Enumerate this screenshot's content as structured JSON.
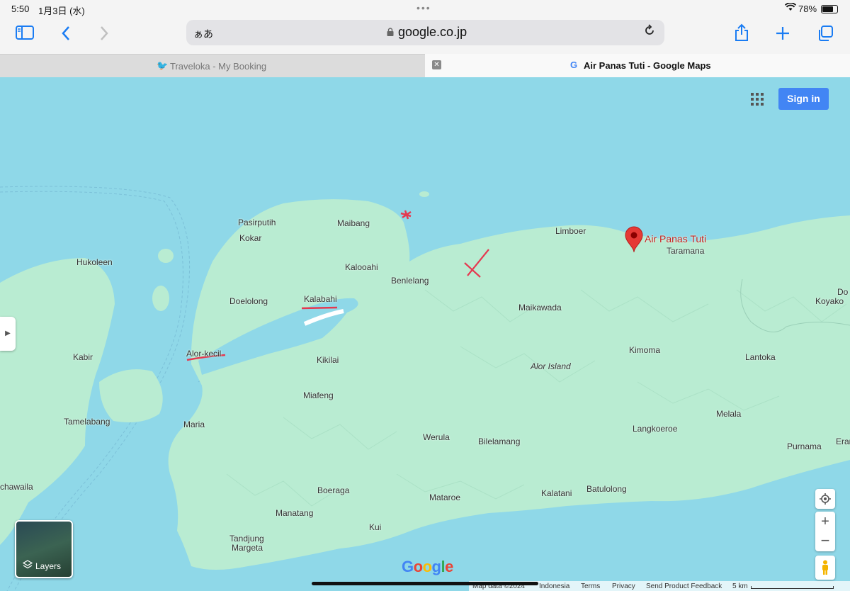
{
  "status_bar": {
    "time": "5:50",
    "date": "1月3日 (水)",
    "battery_pct": "78%"
  },
  "toolbar": {
    "text_size": "ぁあ",
    "url": "google.co.jp"
  },
  "tabs": [
    {
      "title": "Traveloka - My Booking"
    },
    {
      "title": "Air Panas Tuti - Google Maps"
    }
  ],
  "map": {
    "sign_in": "Sign in",
    "pin_label": "Air Panas Tuti",
    "layers_label": "Layers",
    "google_logo": "Google",
    "places": [
      "Pasirputih",
      "Kokar",
      "Maibang",
      "Hukoleen",
      "Kalooahi",
      "Benlelang",
      "Limboer",
      "Taramana",
      "Doelolong",
      "Kalabahi",
      "Maikawada",
      "Kimoma",
      "Lantoka",
      "Kabir",
      "Alor-kecil",
      "Kikilai",
      "Alor Island",
      "Miafeng",
      "Tamelabang",
      "Maria",
      "Werula",
      "Bilelamang",
      "Langkoeroe",
      "Melala",
      "Purnama",
      "Boeraga",
      "Mataroe",
      "Kalatani",
      "Batulolong",
      "Manatang",
      "Kui",
      "Tandjung",
      "Margeta",
      "Do",
      "Koyako",
      "Eran",
      "chawaila"
    ],
    "footer": [
      "Map data ©2024",
      "Indonesia",
      "Terms",
      "Privacy",
      "Send Product Feedback",
      "5 km"
    ]
  },
  "colors": {
    "water": "#8fd8e8",
    "land": "#b9ecd2",
    "pin": "#e53935",
    "accent": "#1a7cf3",
    "sign_in_bg": "#4285f4"
  }
}
